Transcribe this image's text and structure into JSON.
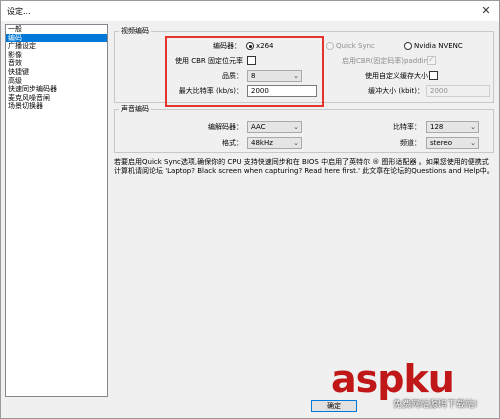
{
  "window": {
    "title": "设定...",
    "close_glyph": "✕"
  },
  "sidebar": {
    "items": [
      {
        "label": "一般",
        "selected": false
      },
      {
        "label": "编码",
        "selected": true
      },
      {
        "label": "广播设定",
        "selected": false
      },
      {
        "label": "影像",
        "selected": false
      },
      {
        "label": "音效",
        "selected": false
      },
      {
        "label": "快捷键",
        "selected": false
      },
      {
        "label": "高级",
        "selected": false
      },
      {
        "label": "快速同步编码器",
        "selected": false
      },
      {
        "label": "麦克风噪音闸",
        "selected": false
      },
      {
        "label": "场景切换器",
        "selected": false
      }
    ]
  },
  "video": {
    "group_title": "视频编码",
    "encoder_label": "编码器：",
    "x264_label": "x264",
    "quicksync_label": "Quick Sync",
    "nvenc_label": "Nvidia NVENC",
    "cbr_label": "使用 CBR 固定位元率",
    "cbr_padding_label": "启用CBR(固定码率)padding",
    "quality_label": "品质：",
    "quality_value": "8",
    "custom_buffer_label": "使用自定义缓存大小",
    "max_bitrate_label": "最大比特率 (kb/s)：",
    "max_bitrate_value": "2000",
    "buffer_size_label": "缓冲大小 (kbit)：",
    "buffer_size_value": "2000"
  },
  "audio": {
    "group_title": "声音编码",
    "codec_label": "编解码器：",
    "codec_value": "AAC",
    "bitrate_label": "比特率：",
    "bitrate_value": "128",
    "format_label": "格式：",
    "format_value": "48kHz",
    "channel_label": "频道：",
    "channel_value": "stereo"
  },
  "info_text": "若要启用Quick Sync选项,确保你的 CPU 支持快速同步和在 BIOS 中启用了英特尔 ® 图形适配器 。如果您使用的便携式计算机请阅论坛 'Laptop? Black screen when capturing? Read here first.' 此文章在论坛的Questions and Help中。",
  "buttons": {
    "ok_label": "确定"
  },
  "watermark": {
    "logo_text": "aspku",
    "subtext": "免费网站源码下载站!"
  },
  "colors": {
    "selection": "#0078d7",
    "highlight_box": "#e3342f",
    "watermark": "#c01818"
  }
}
